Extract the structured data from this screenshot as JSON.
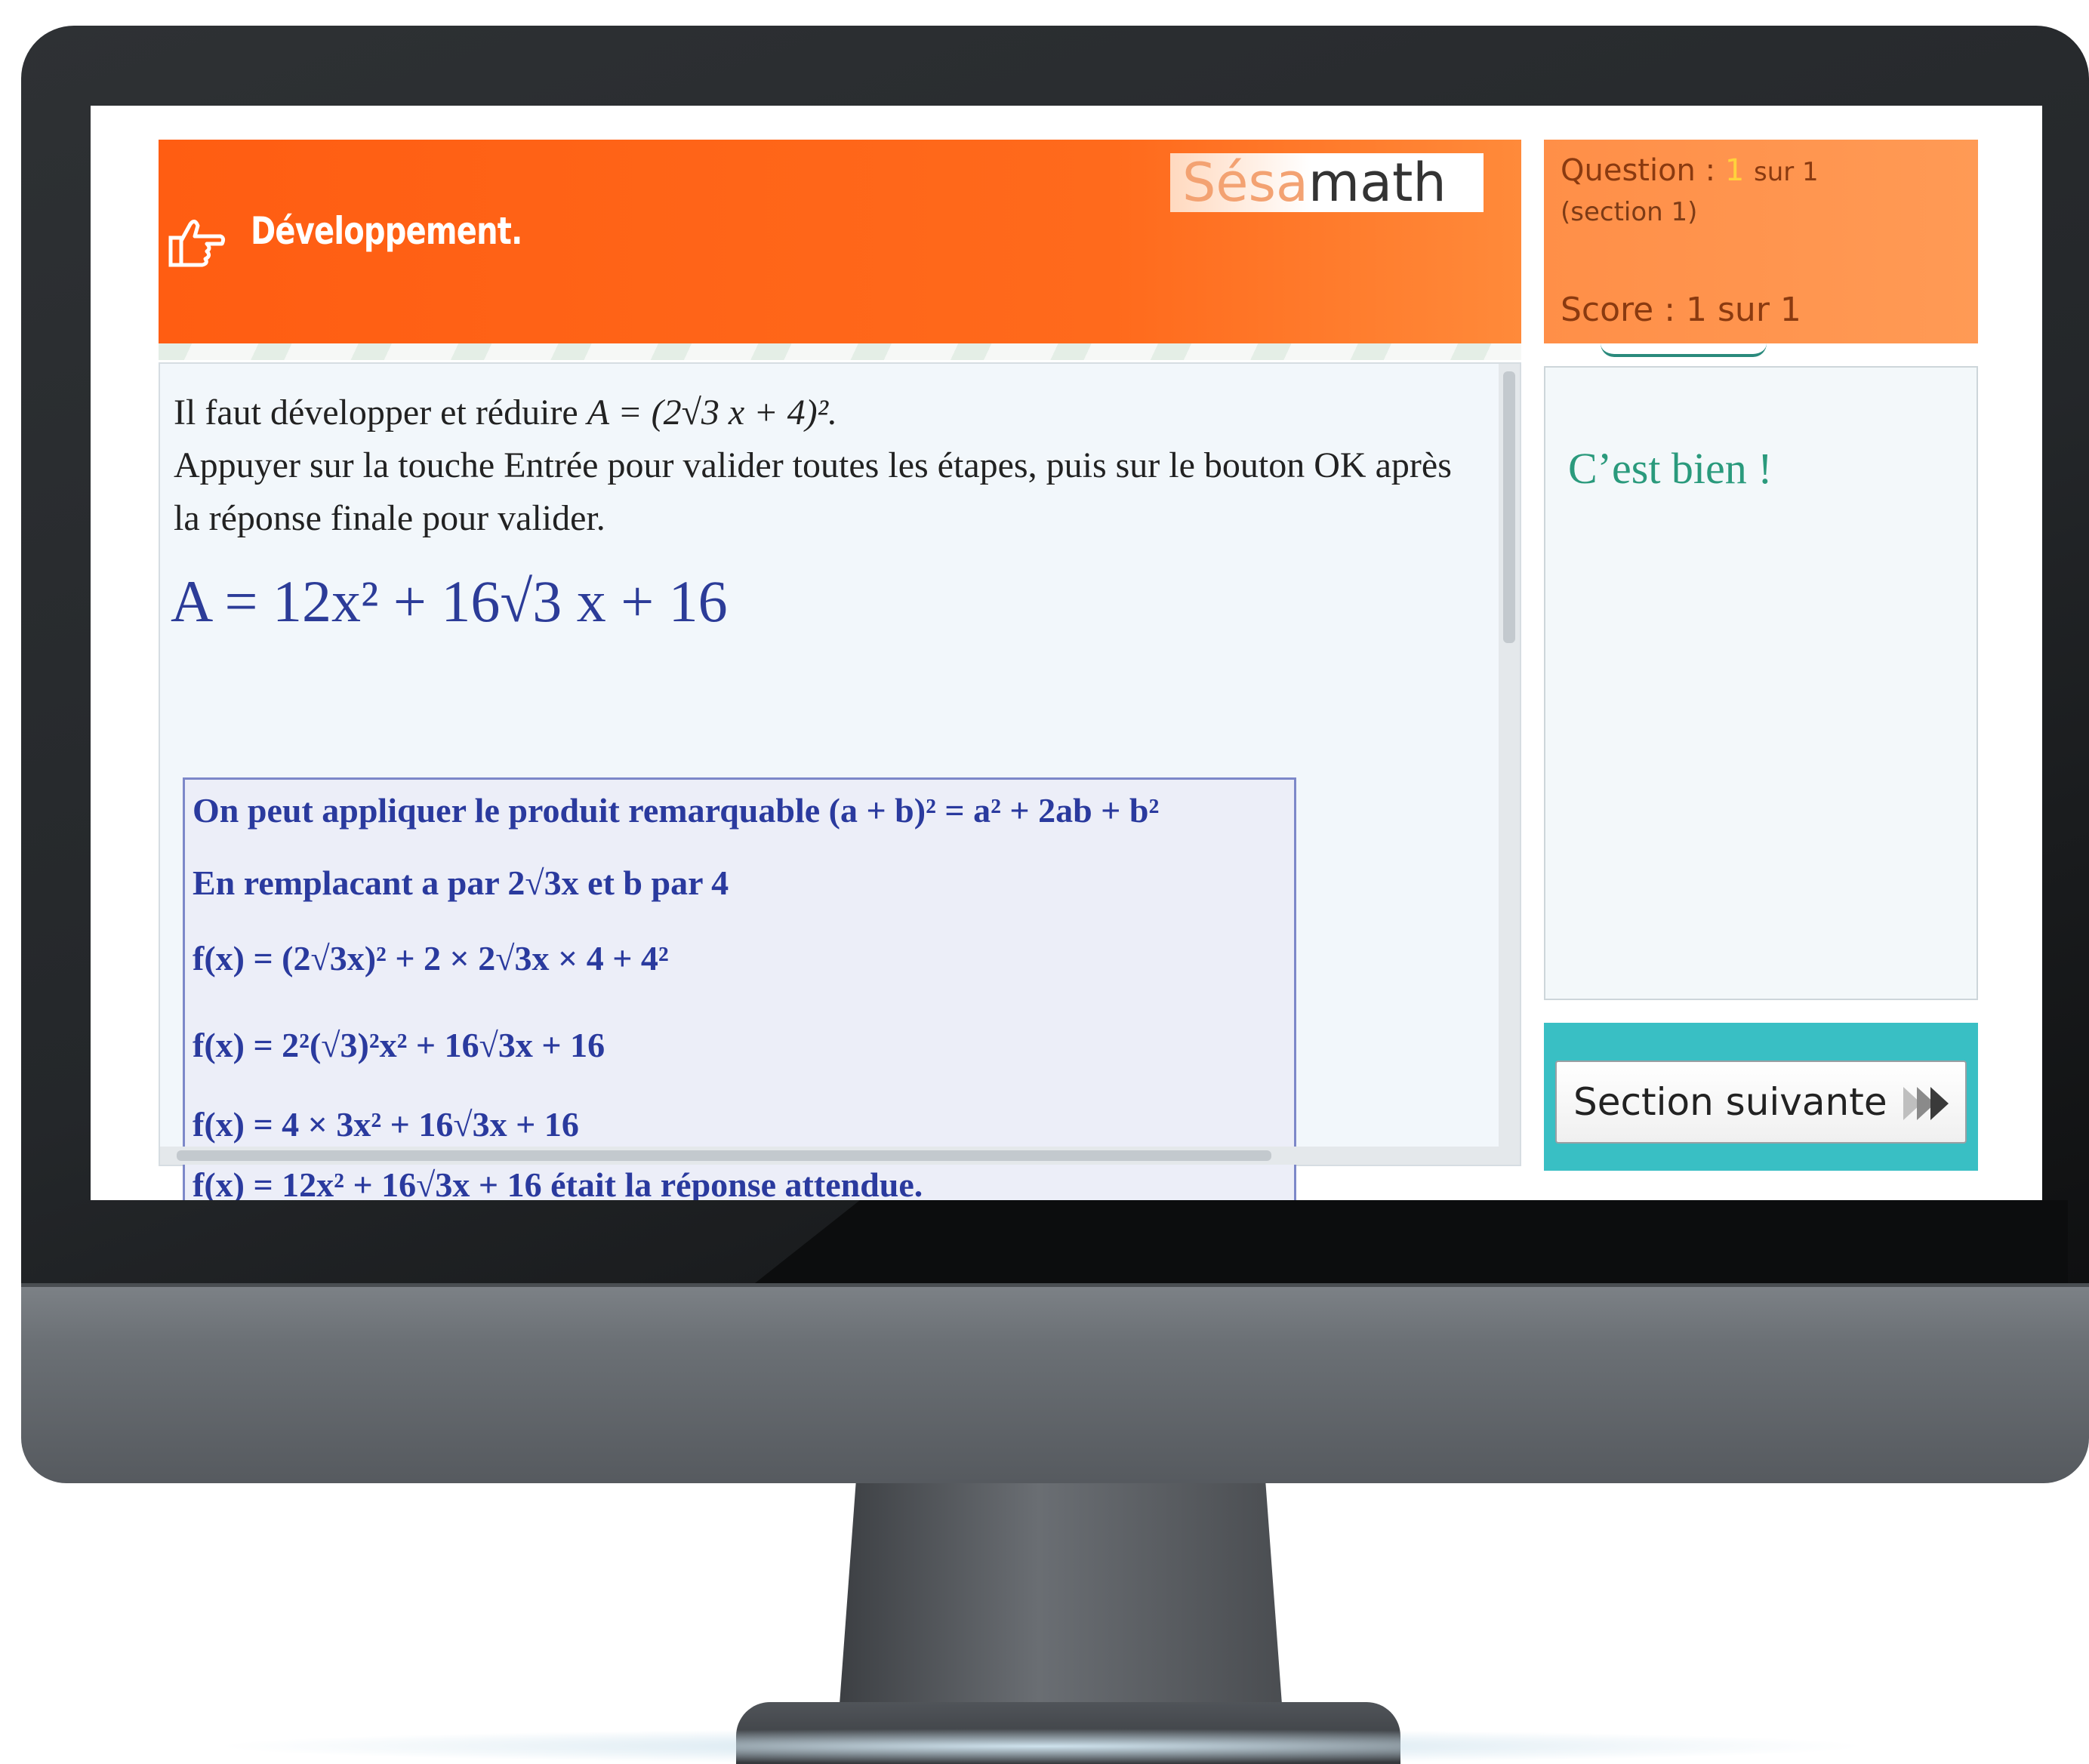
{
  "header": {
    "title": "Développement.",
    "logo_prefix": "Sésa",
    "logo_suffix": "math"
  },
  "info": {
    "question_label": "Question :",
    "question_number": "1",
    "question_total": "sur 1",
    "section": "(section 1)",
    "score": "Score : 1 sur 1"
  },
  "exercise": {
    "instruction_prefix": "Il faut développer et réduire",
    "instruction_expr": "A = (2√3 x + 4)².",
    "validation_text": "Appuyer sur la touche Entrée pour valider toutes les étapes, puis sur le bouton OK après la réponse finale pour valider.",
    "answer": "A = 12x² + 16√3 x + 16"
  },
  "correction": {
    "line1": "On peut appliquer le produit remarquable (a + b)² = a² + 2ab + b²",
    "line2": "En remplacant a par 2√3x et b par 4",
    "line3": "f(x) = (2√3x)² + 2 × 2√3x × 4 + 4²",
    "line4": "f(x) = 2²(√3)²x² + 16√3x + 16",
    "line5": "f(x) = 4 × 3x² + 16√3x + 16",
    "line6": "f(x) = 12x² + 16√3x + 16 était la réponse attendue."
  },
  "feedback": {
    "message": "C’est bien !"
  },
  "navigation": {
    "next_label": "Section suivante"
  },
  "icons": {
    "hand": "pointing-hand-icon",
    "next": "double-chevron-right-icon"
  },
  "colors": {
    "header_orange": "#ff5d12",
    "info_orange": "#ff9a55",
    "answer_blue": "#2c3c98",
    "feedback_green": "#2a9a7c",
    "nav_teal": "#39bfc4"
  }
}
